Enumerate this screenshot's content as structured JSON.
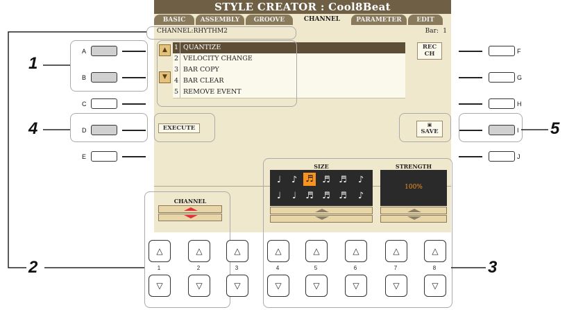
{
  "screen": {
    "title": "STYLE CREATOR : Cool8Beat",
    "tabs": [
      "BASIC",
      "ASSEMBLY",
      "GROOVE",
      "CHANNEL",
      "PARAMETER",
      "EDIT"
    ],
    "active_tab": "CHANNEL",
    "channel_label": "CHANNEL:RHYTHM2",
    "bar_label": "Bar:",
    "bar_value": "1",
    "menu": [
      {
        "num": "1",
        "label": "QUANTIZE",
        "selected": true
      },
      {
        "num": "2",
        "label": "VELOCITY CHANGE"
      },
      {
        "num": "3",
        "label": "BAR COPY"
      },
      {
        "num": "4",
        "label": "BAR CLEAR"
      },
      {
        "num": "5",
        "label": "REMOVE EVENT"
      }
    ],
    "rec_ch_line1": "REC",
    "rec_ch_line2": "CH",
    "execute": "EXECUTE",
    "save": "SAVE",
    "channel_ctrl": "CHANNEL",
    "size_label": "SIZE",
    "strength_label": "STRENGTH",
    "strength_value": "100%",
    "notes_row1": [
      "♩",
      "♪",
      "♬",
      "♬",
      "♬",
      "♪"
    ],
    "notes_row2": [
      "♩",
      "♩",
      "♬",
      "♬",
      "♬",
      "♪"
    ],
    "accent_color": "#f7931e"
  },
  "left_buttons": [
    "A",
    "B",
    "C",
    "D",
    "E"
  ],
  "right_buttons": [
    "F",
    "G",
    "H",
    "I",
    "J"
  ],
  "bottom_numbers": [
    "1",
    "2",
    "3",
    "4",
    "5",
    "6",
    "7",
    "8"
  ],
  "callouts": [
    "1",
    "2",
    "3",
    "4",
    "5"
  ]
}
